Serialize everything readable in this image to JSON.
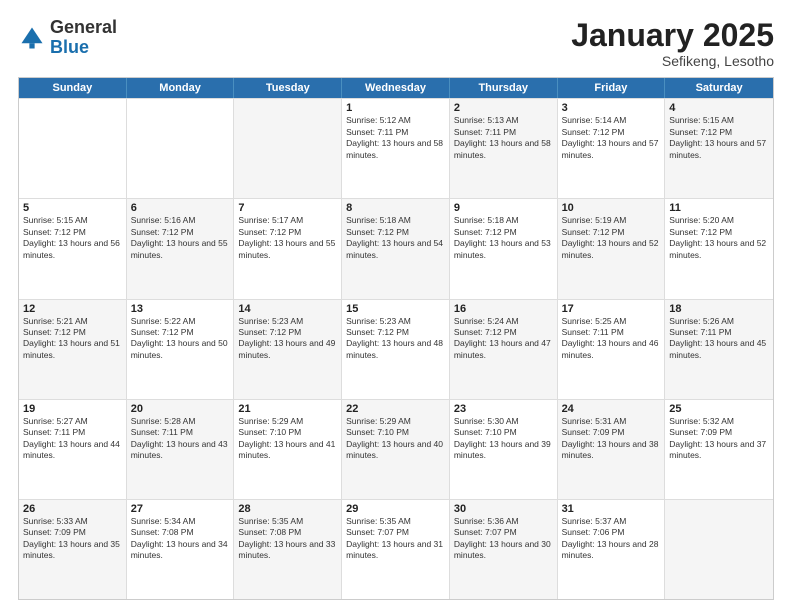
{
  "header": {
    "logo": {
      "general": "General",
      "blue": "Blue"
    },
    "title": "January 2025",
    "location": "Sefikeng, Lesotho"
  },
  "weekdays": [
    "Sunday",
    "Monday",
    "Tuesday",
    "Wednesday",
    "Thursday",
    "Friday",
    "Saturday"
  ],
  "rows": [
    [
      {
        "day": "",
        "sunrise": "",
        "sunset": "",
        "daylight": "",
        "alt": false
      },
      {
        "day": "",
        "sunrise": "",
        "sunset": "",
        "daylight": "",
        "alt": false
      },
      {
        "day": "",
        "sunrise": "",
        "sunset": "",
        "daylight": "",
        "alt": true
      },
      {
        "day": "1",
        "sunrise": "Sunrise: 5:12 AM",
        "sunset": "Sunset: 7:11 PM",
        "daylight": "Daylight: 13 hours and 58 minutes.",
        "alt": false
      },
      {
        "day": "2",
        "sunrise": "Sunrise: 5:13 AM",
        "sunset": "Sunset: 7:11 PM",
        "daylight": "Daylight: 13 hours and 58 minutes.",
        "alt": true
      },
      {
        "day": "3",
        "sunrise": "Sunrise: 5:14 AM",
        "sunset": "Sunset: 7:12 PM",
        "daylight": "Daylight: 13 hours and 57 minutes.",
        "alt": false
      },
      {
        "day": "4",
        "sunrise": "Sunrise: 5:15 AM",
        "sunset": "Sunset: 7:12 PM",
        "daylight": "Daylight: 13 hours and 57 minutes.",
        "alt": true
      }
    ],
    [
      {
        "day": "5",
        "sunrise": "Sunrise: 5:15 AM",
        "sunset": "Sunset: 7:12 PM",
        "daylight": "Daylight: 13 hours and 56 minutes.",
        "alt": false
      },
      {
        "day": "6",
        "sunrise": "Sunrise: 5:16 AM",
        "sunset": "Sunset: 7:12 PM",
        "daylight": "Daylight: 13 hours and 55 minutes.",
        "alt": true
      },
      {
        "day": "7",
        "sunrise": "Sunrise: 5:17 AM",
        "sunset": "Sunset: 7:12 PM",
        "daylight": "Daylight: 13 hours and 55 minutes.",
        "alt": false
      },
      {
        "day": "8",
        "sunrise": "Sunrise: 5:18 AM",
        "sunset": "Sunset: 7:12 PM",
        "daylight": "Daylight: 13 hours and 54 minutes.",
        "alt": true
      },
      {
        "day": "9",
        "sunrise": "Sunrise: 5:18 AM",
        "sunset": "Sunset: 7:12 PM",
        "daylight": "Daylight: 13 hours and 53 minutes.",
        "alt": false
      },
      {
        "day": "10",
        "sunrise": "Sunrise: 5:19 AM",
        "sunset": "Sunset: 7:12 PM",
        "daylight": "Daylight: 13 hours and 52 minutes.",
        "alt": true
      },
      {
        "day": "11",
        "sunrise": "Sunrise: 5:20 AM",
        "sunset": "Sunset: 7:12 PM",
        "daylight": "Daylight: 13 hours and 52 minutes.",
        "alt": false
      }
    ],
    [
      {
        "day": "12",
        "sunrise": "Sunrise: 5:21 AM",
        "sunset": "Sunset: 7:12 PM",
        "daylight": "Daylight: 13 hours and 51 minutes.",
        "alt": true
      },
      {
        "day": "13",
        "sunrise": "Sunrise: 5:22 AM",
        "sunset": "Sunset: 7:12 PM",
        "daylight": "Daylight: 13 hours and 50 minutes.",
        "alt": false
      },
      {
        "day": "14",
        "sunrise": "Sunrise: 5:23 AM",
        "sunset": "Sunset: 7:12 PM",
        "daylight": "Daylight: 13 hours and 49 minutes.",
        "alt": true
      },
      {
        "day": "15",
        "sunrise": "Sunrise: 5:23 AM",
        "sunset": "Sunset: 7:12 PM",
        "daylight": "Daylight: 13 hours and 48 minutes.",
        "alt": false
      },
      {
        "day": "16",
        "sunrise": "Sunrise: 5:24 AM",
        "sunset": "Sunset: 7:12 PM",
        "daylight": "Daylight: 13 hours and 47 minutes.",
        "alt": true
      },
      {
        "day": "17",
        "sunrise": "Sunrise: 5:25 AM",
        "sunset": "Sunset: 7:11 PM",
        "daylight": "Daylight: 13 hours and 46 minutes.",
        "alt": false
      },
      {
        "day": "18",
        "sunrise": "Sunrise: 5:26 AM",
        "sunset": "Sunset: 7:11 PM",
        "daylight": "Daylight: 13 hours and 45 minutes.",
        "alt": true
      }
    ],
    [
      {
        "day": "19",
        "sunrise": "Sunrise: 5:27 AM",
        "sunset": "Sunset: 7:11 PM",
        "daylight": "Daylight: 13 hours and 44 minutes.",
        "alt": false
      },
      {
        "day": "20",
        "sunrise": "Sunrise: 5:28 AM",
        "sunset": "Sunset: 7:11 PM",
        "daylight": "Daylight: 13 hours and 43 minutes.",
        "alt": true
      },
      {
        "day": "21",
        "sunrise": "Sunrise: 5:29 AM",
        "sunset": "Sunset: 7:10 PM",
        "daylight": "Daylight: 13 hours and 41 minutes.",
        "alt": false
      },
      {
        "day": "22",
        "sunrise": "Sunrise: 5:29 AM",
        "sunset": "Sunset: 7:10 PM",
        "daylight": "Daylight: 13 hours and 40 minutes.",
        "alt": true
      },
      {
        "day": "23",
        "sunrise": "Sunrise: 5:30 AM",
        "sunset": "Sunset: 7:10 PM",
        "daylight": "Daylight: 13 hours and 39 minutes.",
        "alt": false
      },
      {
        "day": "24",
        "sunrise": "Sunrise: 5:31 AM",
        "sunset": "Sunset: 7:09 PM",
        "daylight": "Daylight: 13 hours and 38 minutes.",
        "alt": true
      },
      {
        "day": "25",
        "sunrise": "Sunrise: 5:32 AM",
        "sunset": "Sunset: 7:09 PM",
        "daylight": "Daylight: 13 hours and 37 minutes.",
        "alt": false
      }
    ],
    [
      {
        "day": "26",
        "sunrise": "Sunrise: 5:33 AM",
        "sunset": "Sunset: 7:09 PM",
        "daylight": "Daylight: 13 hours and 35 minutes.",
        "alt": true
      },
      {
        "day": "27",
        "sunrise": "Sunrise: 5:34 AM",
        "sunset": "Sunset: 7:08 PM",
        "daylight": "Daylight: 13 hours and 34 minutes.",
        "alt": false
      },
      {
        "day": "28",
        "sunrise": "Sunrise: 5:35 AM",
        "sunset": "Sunset: 7:08 PM",
        "daylight": "Daylight: 13 hours and 33 minutes.",
        "alt": true
      },
      {
        "day": "29",
        "sunrise": "Sunrise: 5:35 AM",
        "sunset": "Sunset: 7:07 PM",
        "daylight": "Daylight: 13 hours and 31 minutes.",
        "alt": false
      },
      {
        "day": "30",
        "sunrise": "Sunrise: 5:36 AM",
        "sunset": "Sunset: 7:07 PM",
        "daylight": "Daylight: 13 hours and 30 minutes.",
        "alt": true
      },
      {
        "day": "31",
        "sunrise": "Sunrise: 5:37 AM",
        "sunset": "Sunset: 7:06 PM",
        "daylight": "Daylight: 13 hours and 28 minutes.",
        "alt": false
      },
      {
        "day": "",
        "sunrise": "",
        "sunset": "",
        "daylight": "",
        "alt": true
      }
    ]
  ]
}
